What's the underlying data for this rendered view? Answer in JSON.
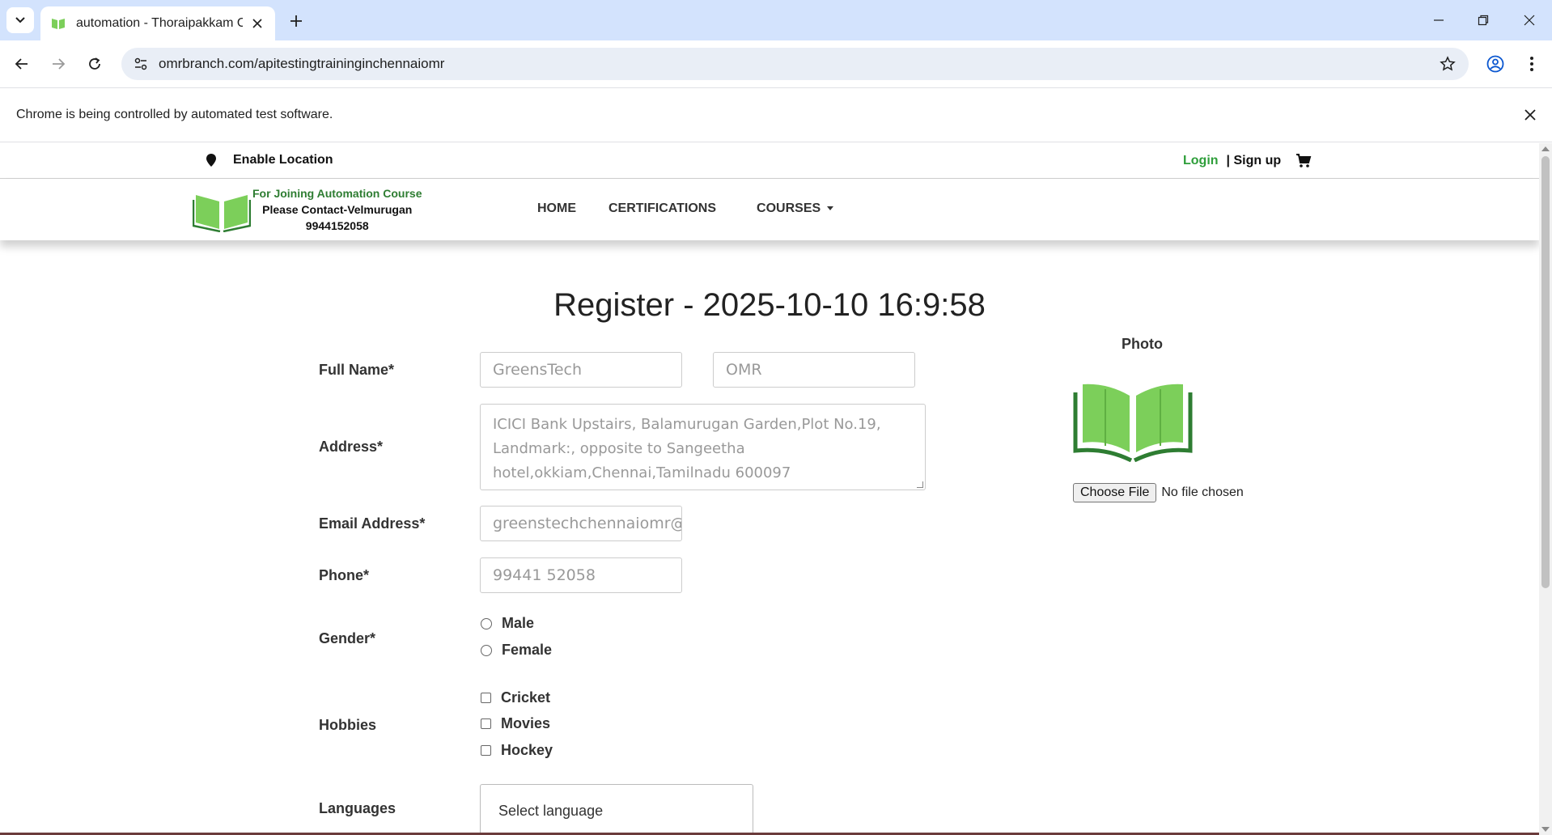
{
  "browser": {
    "tab_title": "automation - Thoraipakkam OMR",
    "url": "omrbranch.com/apitestingtraininginchennaiomr",
    "infobar_text": "Chrome is being controlled by automated test software."
  },
  "topbar": {
    "enable_location": "Enable Location",
    "login": "Login",
    "signup": "| Sign up"
  },
  "brand": {
    "line1": "For Joining Automation Course",
    "line2": "Please Contact-Velmurugan",
    "line3": "9944152058"
  },
  "nav": {
    "home": "HOME",
    "certifications": "CERTIFICATIONS",
    "courses": "COURSES"
  },
  "form": {
    "title": "Register - 2025-10-10 16:9:58",
    "full_name_label": "Full Name*",
    "first_name_placeholder": "GreensTech",
    "last_name_placeholder": "OMR",
    "address_label": "Address*",
    "address_placeholder": "ICICI Bank Upstairs, Balamurugan Garden,Plot No.19, Landmark:, opposite to Sangeetha hotel,okkiam,Chennai,Tamilnadu 600097",
    "email_label": "Email Address*",
    "email_placeholder": "greenstechchennaiomr@",
    "phone_label": "Phone*",
    "phone_placeholder": "99441 52058",
    "gender_label": "Gender*",
    "gender_options": [
      "Male",
      "Female"
    ],
    "hobbies_label": "Hobbies",
    "hobby_options": [
      "Cricket",
      "Movies",
      "Hockey"
    ],
    "languages_label": "Languages",
    "language_placeholder": "Select language",
    "photo_label": "Photo",
    "choose_file": "Choose File",
    "file_status": "No file chosen"
  },
  "colors": {
    "brand_green": "#2e9e3a",
    "book_green": "#7ccf5a",
    "tabstrip": "#d3e3fd"
  }
}
